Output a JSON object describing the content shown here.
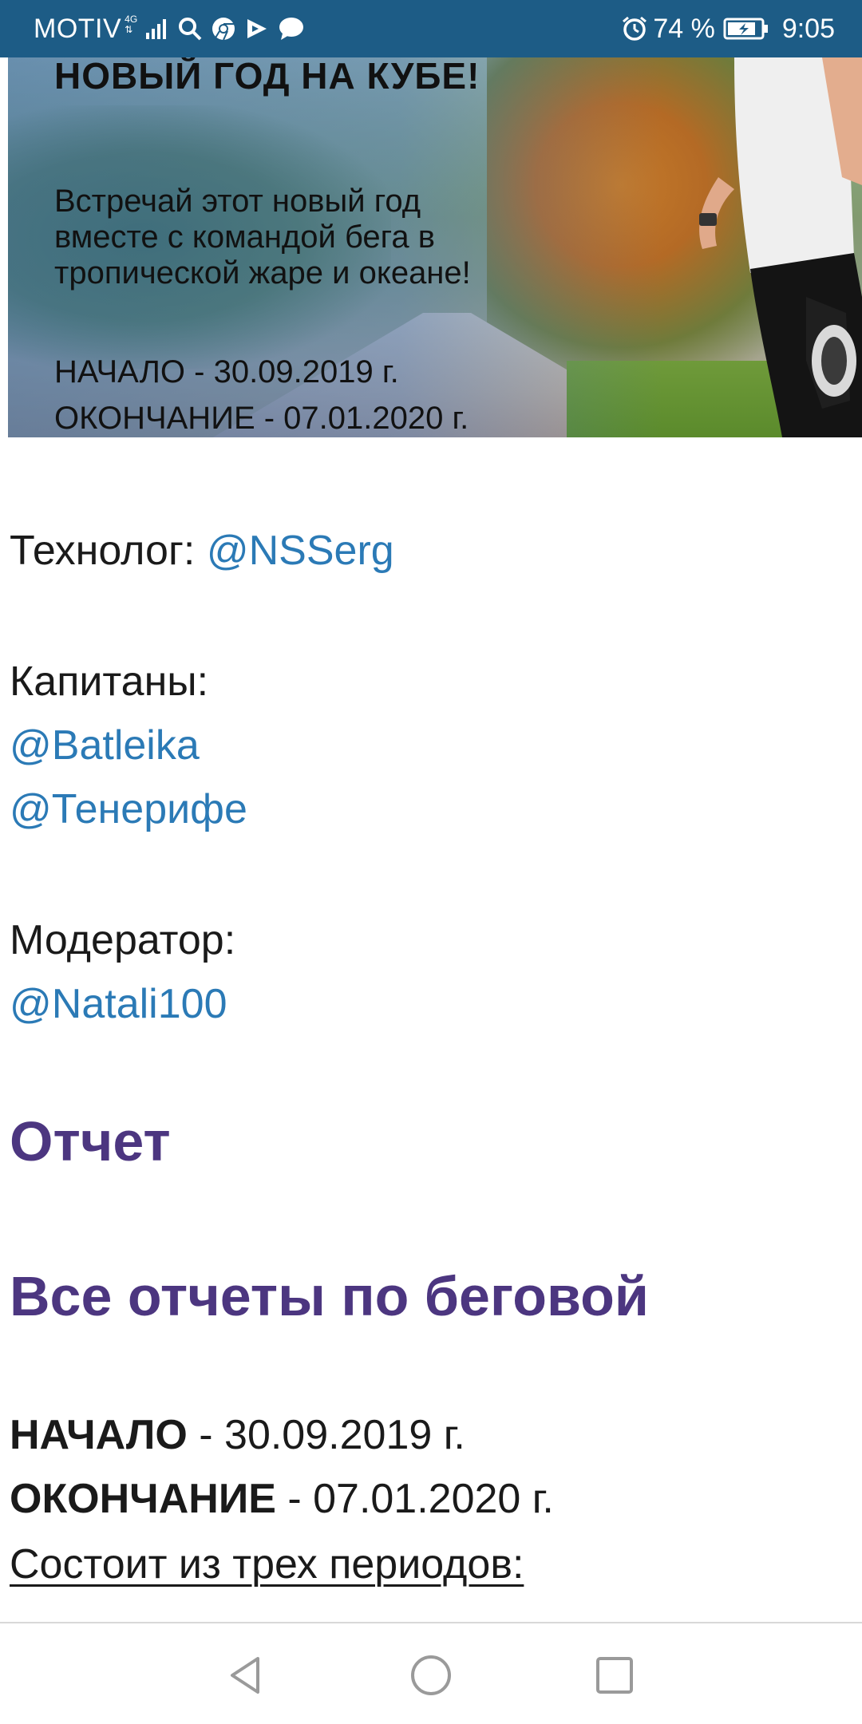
{
  "status_bar": {
    "carrier": "MOTIV",
    "network_top": "4G",
    "network_bottom": "⇅",
    "battery_percent": "74 %",
    "time": "9:05",
    "icons": [
      "signal-icon",
      "search-icon",
      "chrome-icon",
      "play-icon",
      "chat-icon",
      "alarm-icon",
      "battery-icon"
    ]
  },
  "banner": {
    "title": "НОВЫЙ ГОД НА КУБЕ!",
    "desc_line1": "Встречай этот новый год",
    "desc_line2": "вместе с командой бега в",
    "desc_line3": "тропической жаре и океане!",
    "start": "НАЧАЛО - 30.09.2019 г.",
    "end": "ОКОНЧАНИЕ - 07.01.2020 г."
  },
  "team": {
    "technologist_label": "Технолог: ",
    "technologist_link": "@NSSerg",
    "captains_label": "Капитаны:",
    "captain1": "@Batleika",
    "captain2": "@Тенерифе",
    "moderator_label": "Модератор:",
    "moderator_link": "@Natali100"
  },
  "headings": {
    "report": "Отчет",
    "all_reports": "Все отчеты по беговой"
  },
  "dates": {
    "start_label": "НАЧАЛО",
    "start_value": " - 30.09.2019 г.",
    "end_label": "ОКОНЧАНИЕ",
    "end_value": " - 07.01.2020 г.",
    "periods": "Состоит из трех периодов:"
  },
  "colors": {
    "status_bar": "#1d5c86",
    "link": "#2b7ab6",
    "heading": "#4c3680"
  }
}
